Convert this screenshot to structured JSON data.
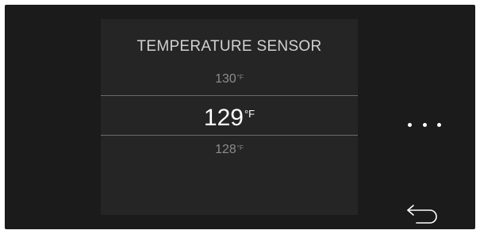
{
  "panel": {
    "title": "TEMPERATURE SENSOR"
  },
  "picker": {
    "previous": {
      "value": "130",
      "unit": "°F"
    },
    "current": {
      "value": "129",
      "unit": "°F"
    },
    "next": {
      "value": "128",
      "unit": "°F"
    }
  },
  "controls": {
    "more_icon": "more-horizontal-icon",
    "back_icon": "back-arrow-icon"
  },
  "colors": {
    "screen_bg": "#1b1b1b",
    "panel_bg": "#252525",
    "text_primary": "#ffffff",
    "text_secondary": "#8c8c8c"
  }
}
